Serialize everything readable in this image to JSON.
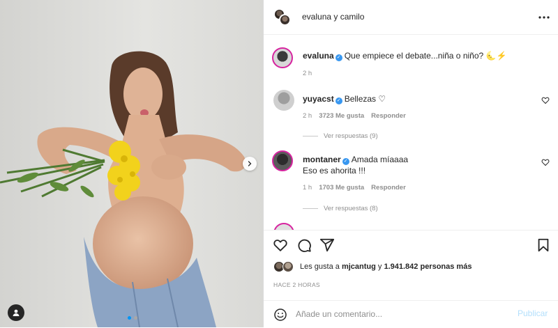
{
  "header": {
    "title": "evaluna y camilo",
    "more_icon": "more-horizontal-icon"
  },
  "caption": {
    "username": "evaluna",
    "verified": true,
    "text": "Que empiece el debate...niña o niño?",
    "emojis": "🌜⚡",
    "time": "2 h"
  },
  "comments": [
    {
      "username": "yuyacst",
      "verified": true,
      "text": "Bellezas ♡",
      "time": "2 h",
      "likes": "3723 Me gusta",
      "reply": "Responder",
      "view_replies": "Ver respuestas (9)"
    },
    {
      "username": "montaner",
      "verified": true,
      "text": "Amada míaaaa",
      "text2": "Eso es ahorita !!!",
      "time": "1 h",
      "likes": "1703 Me gusta",
      "reply": "Responder",
      "view_replies": "Ver respuestas (8)"
    }
  ],
  "likes": {
    "prefix": "Les gusta a",
    "user": "mjcantug",
    "joiner": "y",
    "count": "1.941.842",
    "suffix": "personas más"
  },
  "timestamp": "HACE 2 HORAS",
  "comment_box": {
    "placeholder": "Añade un comentario...",
    "publish": "Publicar"
  },
  "colors": {
    "verified": "#3897f0",
    "publish_disabled": "#b2dffc",
    "secondary_text": "#8e8e8e",
    "active_dot": "#0095f6"
  }
}
